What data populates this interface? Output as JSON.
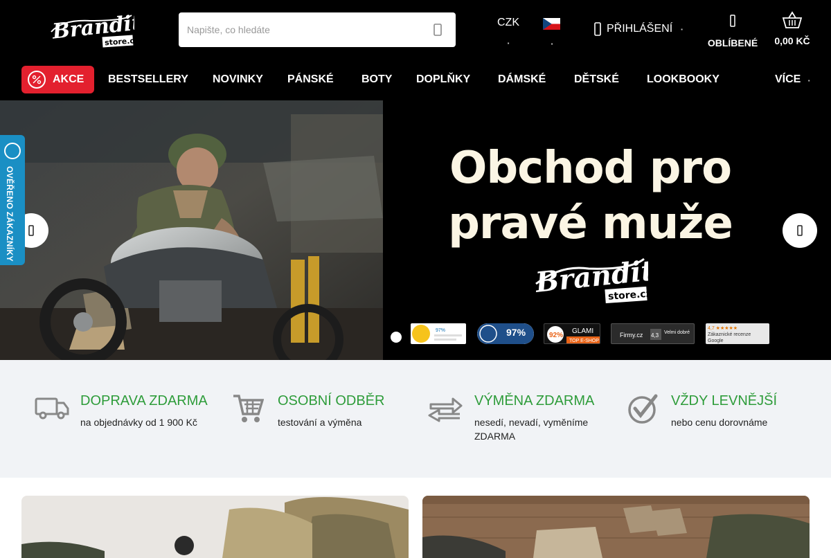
{
  "brand": {
    "logo_text": "Brandit",
    "logo_sub": "store.cz"
  },
  "search": {
    "placeholder": "Napište, co hledáte",
    "icon": "search-icon"
  },
  "header": {
    "currency": "CZK",
    "flag": "czech-flag",
    "login_label": "PŘIHLÁŠENÍ",
    "favorites_label": "OBLÍBENÉ",
    "cart_total": "0,00 KČ"
  },
  "nav": {
    "items": [
      "AKCE",
      "BESTSELLERY",
      "NOVINKY",
      "PÁNSKÉ",
      "BOTY",
      "DOPLŇKY",
      "DÁMSKÉ",
      "DĚTSKÉ",
      "LOOKBOOKY"
    ],
    "more_label": "VÍCE"
  },
  "hero": {
    "headline_line1": "Obchod pro",
    "headline_line2": "pravé muže",
    "logo_text": "Brandit",
    "logo_sub": "store.cz",
    "badges": [
      {
        "name": "heureka-badge",
        "label": "97%"
      },
      {
        "name": "overeno-badge",
        "label": "97%"
      },
      {
        "name": "glami-badge",
        "label": "92%",
        "sub": "GLAMI",
        "sub2": "TOP E-SHOP"
      },
      {
        "name": "firmy-badge",
        "label": "Firmy.cz",
        "rating": "4,3",
        "rating_text": "Velmi dobré"
      },
      {
        "name": "google-badge",
        "label": "4,7 ★★★★★",
        "sub": "Zákaznické recenze",
        "sub2": "Google"
      }
    ]
  },
  "verified_tab": {
    "label": "OVĚŘENO ZÁKAZNÍKY"
  },
  "benefits": [
    {
      "icon": "truck-icon",
      "title": "DOPRAVA ZDARMA",
      "text": "na objednávky od 1 900 Kč"
    },
    {
      "icon": "shopping-cart-icon",
      "title": "OSOBNÍ ODBĚR",
      "text": "testování a výměna"
    },
    {
      "icon": "exchange-arrows-icon",
      "title": "VÝMĚNA ZDARMA",
      "text": "nesedí, nevadí, vyměníme ZDARMA"
    },
    {
      "icon": "checkmark-circle-icon",
      "title": "VŽDY LEVNĚJŠÍ",
      "text": "nebo cenu dorovnáme"
    }
  ],
  "colors": {
    "accent_red": "#e3202e",
    "benefit_green": "#2e9c3a",
    "header_bg": "#000000",
    "hero_text": "#fbf5e4",
    "verified_blue": "#1a8fc4"
  }
}
